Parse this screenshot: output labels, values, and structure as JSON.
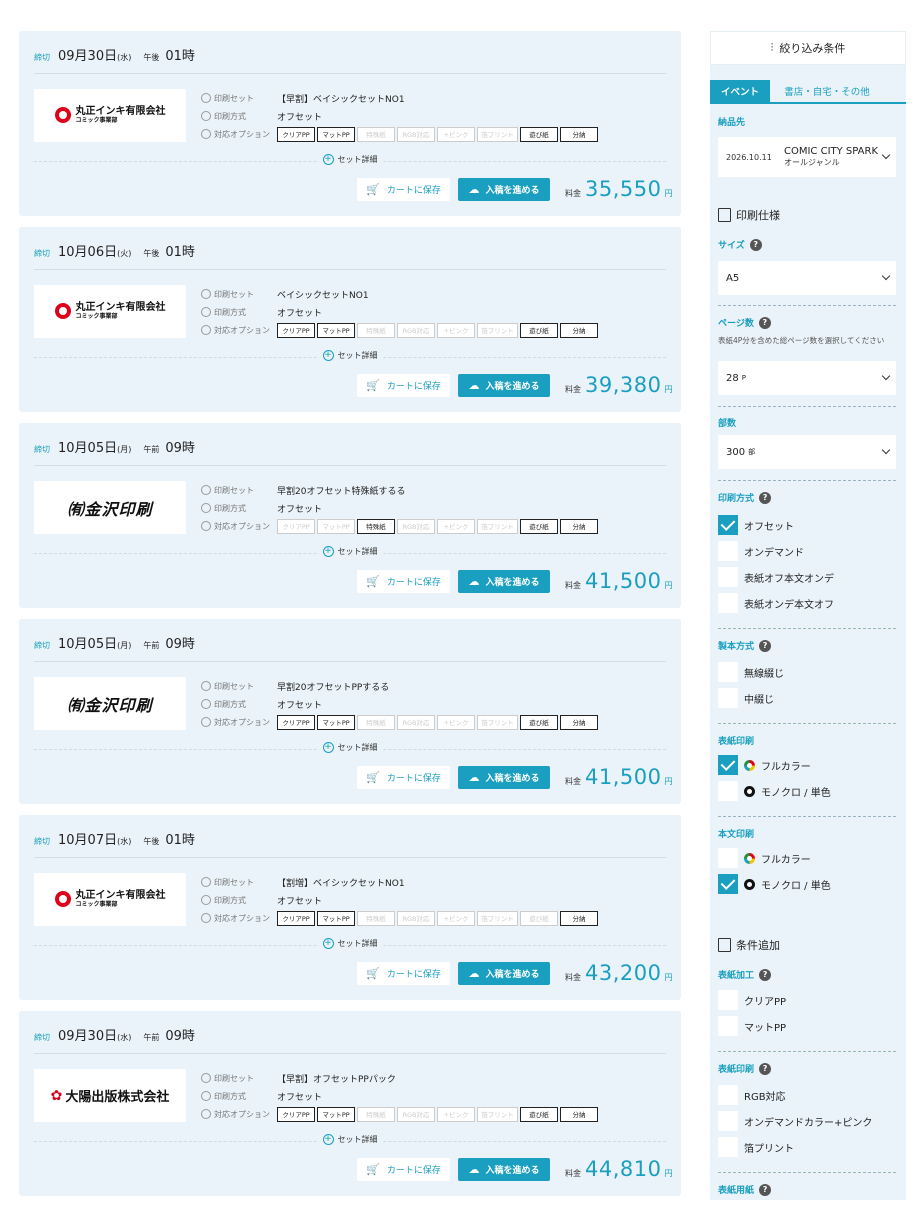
{
  "results": [
    {
      "deadline_tag": "締切",
      "date": "09月30日",
      "weekday": "(水)",
      "ampm": "午後",
      "time": "01時",
      "logo": "maru",
      "logo_text": "丸正インキ有限会社",
      "logo_sub": "コミック事業部",
      "set_name": "【早割】ベイシックセットNO1",
      "method": "オフセット",
      "options": [
        {
          "label": "クリアPP",
          "on": true
        },
        {
          "label": "マットPP",
          "on": true
        },
        {
          "label": "特殊紙",
          "on": false
        },
        {
          "label": "RGB対応",
          "on": false
        },
        {
          "label": "+ピンク",
          "on": false
        },
        {
          "label": "箔プリント",
          "on": false
        },
        {
          "label": "遊び紙",
          "on": true
        },
        {
          "label": "分納",
          "on": true
        }
      ],
      "price": "35,550"
    },
    {
      "deadline_tag": "締切",
      "date": "10月06日",
      "weekday": "(火)",
      "ampm": "午後",
      "time": "01時",
      "logo": "maru",
      "logo_text": "丸正インキ有限会社",
      "logo_sub": "コミック事業部",
      "set_name": "ベイシックセットNO1",
      "method": "オフセット",
      "options": [
        {
          "label": "クリアPP",
          "on": true
        },
        {
          "label": "マットPP",
          "on": true
        },
        {
          "label": "特殊紙",
          "on": false
        },
        {
          "label": "RGB対応",
          "on": false
        },
        {
          "label": "+ピンク",
          "on": false
        },
        {
          "label": "箔プリント",
          "on": false
        },
        {
          "label": "遊び紙",
          "on": true
        },
        {
          "label": "分納",
          "on": true
        }
      ],
      "price": "39,380"
    },
    {
      "deadline_tag": "締切",
      "date": "10月05日",
      "weekday": "(月)",
      "ampm": "午前",
      "time": "09時",
      "logo": "kana",
      "logo_text": "㈲金沢印刷",
      "logo_sub": "",
      "set_name": "早割20オフセット特殊紙するる",
      "method": "オフセット",
      "options": [
        {
          "label": "クリアPP",
          "on": false
        },
        {
          "label": "マットPP",
          "on": false
        },
        {
          "label": "特殊紙",
          "on": true
        },
        {
          "label": "RGB対応",
          "on": false
        },
        {
          "label": "+ピンク",
          "on": false
        },
        {
          "label": "箔プリント",
          "on": false
        },
        {
          "label": "遊び紙",
          "on": true
        },
        {
          "label": "分納",
          "on": true
        }
      ],
      "price": "41,500"
    },
    {
      "deadline_tag": "締切",
      "date": "10月05日",
      "weekday": "(月)",
      "ampm": "午前",
      "time": "09時",
      "logo": "kana",
      "logo_text": "㈲金沢印刷",
      "logo_sub": "",
      "set_name": "早割20オフセットPPするる",
      "method": "オフセット",
      "options": [
        {
          "label": "クリアPP",
          "on": true
        },
        {
          "label": "マットPP",
          "on": true
        },
        {
          "label": "特殊紙",
          "on": false
        },
        {
          "label": "RGB対応",
          "on": false
        },
        {
          "label": "+ピンク",
          "on": false
        },
        {
          "label": "箔プリント",
          "on": false
        },
        {
          "label": "遊び紙",
          "on": true
        },
        {
          "label": "分納",
          "on": true
        }
      ],
      "price": "41,500"
    },
    {
      "deadline_tag": "締切",
      "date": "10月07日",
      "weekday": "(水)",
      "ampm": "午後",
      "time": "01時",
      "logo": "maru",
      "logo_text": "丸正インキ有限会社",
      "logo_sub": "コミック事業部",
      "set_name": "【割増】ベイシックセットNO1",
      "method": "オフセット",
      "options": [
        {
          "label": "クリアPP",
          "on": true
        },
        {
          "label": "マットPP",
          "on": true
        },
        {
          "label": "特殊紙",
          "on": false
        },
        {
          "label": "RGB対応",
          "on": false
        },
        {
          "label": "+ピンク",
          "on": false
        },
        {
          "label": "箔プリント",
          "on": false
        },
        {
          "label": "遊び紙",
          "on": false
        },
        {
          "label": "分納",
          "on": true
        }
      ],
      "price": "43,200"
    },
    {
      "deadline_tag": "締切",
      "date": "09月30日",
      "weekday": "(水)",
      "ampm": "午前",
      "time": "09時",
      "logo": "taiyo",
      "logo_text": "大陽出版株式会社",
      "logo_sub": "",
      "set_name": "【早割】オフセットPPパック",
      "method": "オフセット",
      "options": [
        {
          "label": "クリアPP",
          "on": true
        },
        {
          "label": "マットPP",
          "on": true
        },
        {
          "label": "特殊紙",
          "on": false
        },
        {
          "label": "RGB対応",
          "on": false
        },
        {
          "label": "+ピンク",
          "on": false
        },
        {
          "label": "箔プリント",
          "on": false
        },
        {
          "label": "遊び紙",
          "on": true
        },
        {
          "label": "分納",
          "on": true
        }
      ],
      "price": "44,810"
    }
  ],
  "labels": {
    "set_label": "印刷セット",
    "method_label": "印刷方式",
    "options_label": "対応オプション",
    "detail": "セット詳細",
    "cart": "カートに保存",
    "proceed": "入稿を進める",
    "price_label": "料金",
    "yen": "円"
  },
  "sidebar": {
    "title": "絞り込み条件",
    "tab_event": "イベント",
    "tab_other": "書店・自宅・その他",
    "delivery_label": "納品先",
    "delivery_date": "2026.10.11",
    "delivery_event": "COMIC CITY SPARK",
    "delivery_genre": "オールジャンル",
    "spec_head": "印刷仕様",
    "size_label": "サイズ",
    "size_value": "A5",
    "pages_label": "ページ数",
    "pages_hint": "表紙4P分を含めた総ページ数を選択してください",
    "pages_value": "28",
    "pages_unit": "P",
    "copies_label": "部数",
    "copies_value": "300",
    "copies_unit": "部",
    "method_label": "印刷方式",
    "methods": [
      {
        "label": "オフセット",
        "on": true
      },
      {
        "label": "オンデマンド",
        "on": false
      },
      {
        "label": "表紙オフ本文オンデ",
        "on": false
      },
      {
        "label": "表紙オンデ本文オフ",
        "on": false
      }
    ],
    "binding_label": "製本方式",
    "bindings": [
      {
        "label": "無線綴じ",
        "on": false
      },
      {
        "label": "中綴じ",
        "on": false
      }
    ],
    "cover_label": "表紙印刷",
    "cover": [
      {
        "label": "フルカラー",
        "on": true
      },
      {
        "label": "モノクロ / 単色",
        "on": false
      }
    ],
    "body_label": "本文印刷",
    "body": [
      {
        "label": "フルカラー",
        "on": false
      },
      {
        "label": "モノクロ / 単色",
        "on": true
      }
    ],
    "add_head": "条件追加",
    "finish_label": "表紙加工",
    "finish": [
      {
        "label": "クリアPP",
        "on": false
      },
      {
        "label": "マットPP",
        "on": false
      }
    ],
    "cover2_label": "表紙印刷",
    "cover2": [
      {
        "label": "RGB対応",
        "on": false
      },
      {
        "label": "オンデマンドカラー+ピンク",
        "on": false
      },
      {
        "label": "箔プリント",
        "on": false
      }
    ],
    "paper_label": "表紙用紙"
  },
  "colors": {
    "accent": "#1a9fc0",
    "card_bg": "#eaf3f9",
    "logo_red": "#e0001a"
  }
}
